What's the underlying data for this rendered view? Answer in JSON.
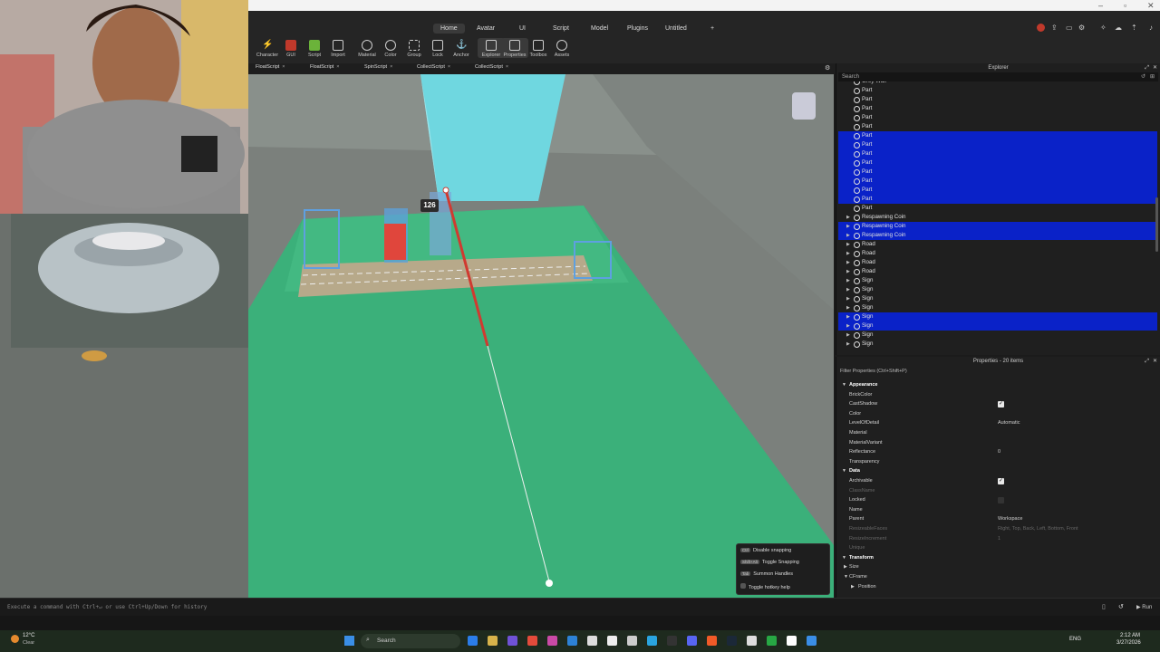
{
  "menu": {
    "tabs": [
      "Home",
      "Avatar",
      "UI",
      "Script",
      "Model",
      "Plugins",
      "Untitled",
      "+"
    ],
    "active": "Home"
  },
  "toolbar": {
    "tools": [
      "Character",
      "GUI",
      "Script",
      "Import",
      "Material",
      "Color",
      "Group",
      "Lock",
      "Anchor",
      "Explorer",
      "Properties",
      "Toolbox",
      "Assets"
    ]
  },
  "script_tabs": [
    "FloatScript",
    "FloatScript",
    "SpinScript",
    "CollectScript",
    "CollectScript"
  ],
  "viewport": {
    "marker_label": "126"
  },
  "explorer": {
    "title": "Explorer",
    "search_placeholder": "Search",
    "items": [
      {
        "label": "Grey Wall",
        "expandable": false,
        "selected": false
      },
      {
        "label": "Part",
        "expandable": false,
        "selected": false
      },
      {
        "label": "Part",
        "expandable": false,
        "selected": false
      },
      {
        "label": "Part",
        "expandable": false,
        "selected": false
      },
      {
        "label": "Part",
        "expandable": false,
        "selected": false
      },
      {
        "label": "Part",
        "expandable": false,
        "selected": false
      },
      {
        "label": "Part",
        "expandable": false,
        "selected": true
      },
      {
        "label": "Part",
        "expandable": false,
        "selected": true
      },
      {
        "label": "Part",
        "expandable": false,
        "selected": true
      },
      {
        "label": "Part",
        "expandable": false,
        "selected": true
      },
      {
        "label": "Part",
        "expandable": false,
        "selected": true
      },
      {
        "label": "Part",
        "expandable": false,
        "selected": true
      },
      {
        "label": "Part",
        "expandable": false,
        "selected": true
      },
      {
        "label": "Part",
        "expandable": false,
        "selected": true
      },
      {
        "label": "Part",
        "expandable": false,
        "selected": false
      },
      {
        "label": "Respawning Coin",
        "expandable": true,
        "selected": false
      },
      {
        "label": "Respawning Coin",
        "expandable": true,
        "selected": true
      },
      {
        "label": "Respawning Coin",
        "expandable": true,
        "selected": true
      },
      {
        "label": "Road",
        "expandable": true,
        "selected": false
      },
      {
        "label": "Road",
        "expandable": true,
        "selected": false
      },
      {
        "label": "Road",
        "expandable": true,
        "selected": false
      },
      {
        "label": "Road",
        "expandable": true,
        "selected": false
      },
      {
        "label": "Sign",
        "expandable": true,
        "selected": false
      },
      {
        "label": "Sign",
        "expandable": true,
        "selected": false
      },
      {
        "label": "Sign",
        "expandable": true,
        "selected": false
      },
      {
        "label": "Sign",
        "expandable": true,
        "selected": false
      },
      {
        "label": "Sign",
        "expandable": true,
        "selected": true
      },
      {
        "label": "Sign",
        "expandable": true,
        "selected": true
      },
      {
        "label": "Sign",
        "expandable": true,
        "selected": false
      },
      {
        "label": "Sign",
        "expandable": true,
        "selected": false
      }
    ]
  },
  "properties": {
    "title": "Properties - 20 items",
    "filter_placeholder": "Filter Properties (Ctrl+Shift+P)",
    "rows": [
      {
        "type": "section",
        "name": "Appearance"
      },
      {
        "name": "BrickColor",
        "value": ""
      },
      {
        "name": "CastShadow",
        "check": true
      },
      {
        "name": "Color",
        "value": ""
      },
      {
        "name": "LevelOfDetail",
        "value": "Automatic"
      },
      {
        "name": "Material",
        "value": ""
      },
      {
        "name": "MaterialVariant",
        "value": ""
      },
      {
        "name": "Reflectance",
        "value": "0"
      },
      {
        "name": "Transparency",
        "value": ""
      },
      {
        "type": "section",
        "name": "Data"
      },
      {
        "name": "Archivable",
        "check": true
      },
      {
        "name": "ClassName",
        "value": "",
        "dim": true
      },
      {
        "name": "Locked",
        "check": false,
        "dim_box": true
      },
      {
        "name": "Name",
        "value": ""
      },
      {
        "name": "Parent",
        "value": "Workspace"
      },
      {
        "name": "ResizeableFaces",
        "value": "Right, Top, Back, Left, Bottom, Front",
        "dim": true
      },
      {
        "name": "ResizeIncrement",
        "value": "1",
        "dim": true
      },
      {
        "name": "Unique",
        "value": "",
        "dim": true
      },
      {
        "type": "section",
        "name": "Transform"
      },
      {
        "name": "Size",
        "value": "",
        "expander": true
      },
      {
        "name": "CFrame",
        "value": "",
        "expander": true,
        "open": true
      },
      {
        "name": "Position",
        "value": "",
        "expander": true,
        "indent": true
      }
    ]
  },
  "hotkeys": [
    {
      "key": "Ctrl",
      "label": "Disable snapping"
    },
    {
      "key": "Shift+Alt",
      "label": "Toggle Snapping"
    },
    {
      "key": "Tab",
      "label": "Summon Handles"
    },
    {
      "key": "",
      "label": "Toggle hotkey help"
    }
  ],
  "command_bar": {
    "placeholder": "Execute a command with Ctrl+↵ or use Ctrl+Up/Down for history",
    "run_label": "Run"
  },
  "taskbar": {
    "weather_temp": "12°C",
    "weather_desc": "Clear",
    "search_label": "Search",
    "lang": "ENG",
    "time": "2:12 AM",
    "date": "3/27/2026"
  }
}
